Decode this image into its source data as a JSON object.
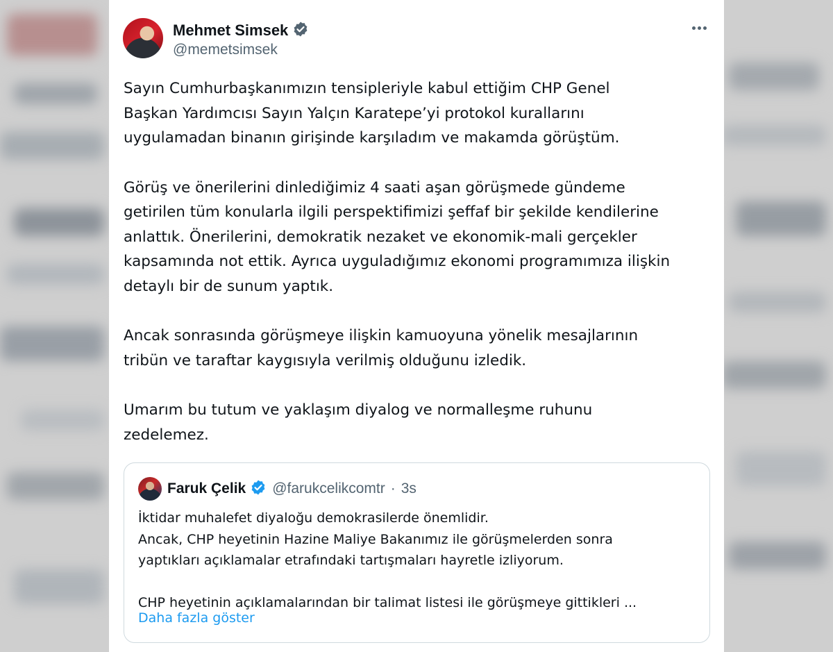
{
  "author": {
    "display_name": "Mehmet Simsek",
    "handle": "@memetsimsek",
    "verified_badge_color": "#536471"
  },
  "more_icon": "more-horizontal-icon",
  "tweet": {
    "paragraphs": [
      "Sayın Cumhurbaşkanımızın tensipleriyle kabul ettiğim CHP Genel\nBaşkan Yardımcısı Sayın Yalçın Karatepe’yi protokol kurallarını\nuygulamadan binanın girişinde karşıladım ve makamda görüştüm.",
      "Görüş ve önerilerini dinlediğimiz 4 saati aşan görüşmede gündeme\ngetirilen tüm konularla ilgili perspektifimizi şeffaf bir şekilde kendilerine\nanlattık. Önerilerini, demokratik nezaket ve ekonomik-mali gerçekler\nkapsamında not ettik. Ayrıca uyguladığımız ekonomi programımıza ilişkin\ndetaylı bir de sunum yaptık.",
      "Ancak sonrasında görüşmeye ilişkin kamuoyuna yönelik mesajlarının\ntribün ve taraftar kaygısıyla verilmiş olduğunu izledik.",
      "Umarım bu tutum ve yaklaşım diyalog ve normalleşme ruhunu\nzedelemez."
    ]
  },
  "quoted_tweet": {
    "display_name": "Faruk Çelik",
    "handle": "@farukcelikcomtr",
    "separator": "·",
    "time": "3s",
    "verified_badge_color": "#1d9bf0",
    "paragraphs": [
      "İktidar muhalefet diyaloğu demokrasilerde önemlidir.\nAncak, CHP heyetinin Hazine Maliye Bakanımız ile görüşmelerden sonra\nyaptıkları açıklamalar etrafındaki tartışmaları hayretle izliyorum.",
      "CHP heyetinin açıklamalarından bir talimat listesi ile görüşmeye gittikleri ..."
    ],
    "show_more_label": "Daha fazla göster"
  },
  "colors": {
    "text_primary": "#0f1419",
    "text_secondary": "#536471",
    "link": "#1d9bf0",
    "border": "#cfd9de"
  }
}
